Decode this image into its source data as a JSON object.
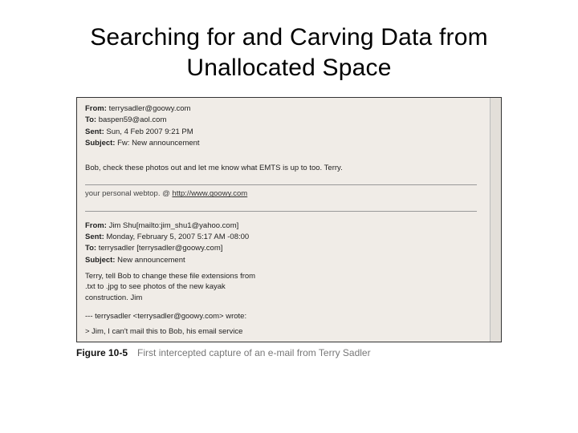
{
  "title": "Searching for and Carving Data from Unallocated Space",
  "email1": {
    "from_label": "From:",
    "from_value": "terrysadler@goowy.com",
    "to_label": "To:",
    "to_value": "baspen59@aol.com",
    "sent_label": "Sent:",
    "sent_value": "Sun, 4 Feb 2007 9:21 PM",
    "subject_label": "Subject:",
    "subject_value": "Fw: New announcement",
    "body": "Bob, check these photos out and let me know what EMTS is up to too. Terry.",
    "webtop_prefix": "your personal webtop. @ ",
    "webtop_url": "http://www.goowy.com"
  },
  "email2": {
    "from_label": "From:",
    "from_value": "Jim Shu[mailto:jim_shu1@yahoo.com]",
    "sent_label": "Sent:",
    "sent_value": "Monday, February 5, 2007 5:17 AM -08:00",
    "to_label": "To:",
    "to_value": "terrysadler [terrysadler@goowy.com]",
    "subject_label": "Subject:",
    "subject_value": "New announcement",
    "body1": "Terry, tell Bob to change these file extensions from",
    "body2": ".txt to .jpg to see photos of the new kayak",
    "body3": "construction. Jim",
    "quote_sep": "--- terrysadler <terrysadler@goowy.com> wrote:",
    "quote_line": "> Jim, I can't mail this to Bob, his email service"
  },
  "figure": {
    "label": "Figure 10-5",
    "caption": "First intercepted capture of an e-mail from Terry Sadler"
  }
}
